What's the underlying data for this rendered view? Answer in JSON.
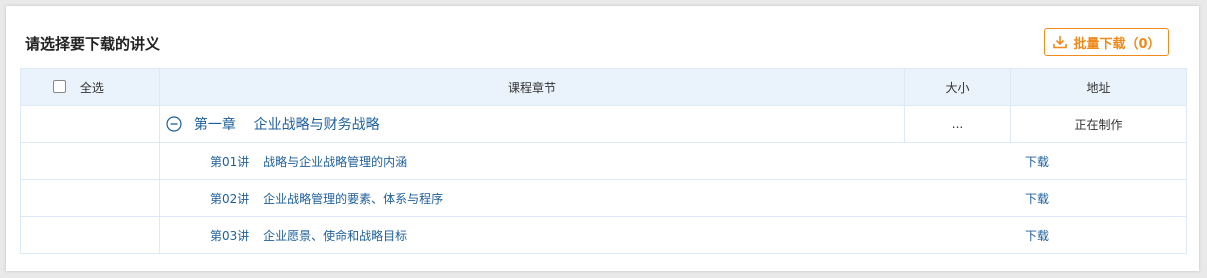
{
  "panel": {
    "title": "请选择要下载的讲义",
    "batch_download_label": "批量下载（0）"
  },
  "table": {
    "headers": {
      "select_all": "全选",
      "chapter": "课程章节",
      "size": "大小",
      "address": "地址"
    },
    "chapter": {
      "number": "第一章",
      "title": "企业战略与财务战略",
      "size": "...",
      "status": "正在制作"
    },
    "lectures": [
      {
        "number": "第01讲",
        "title": "战略与企业战略管理的内涵",
        "action": "下载"
      },
      {
        "number": "第02讲",
        "title": "企业战略管理的要素、体系与程序",
        "action": "下载"
      },
      {
        "number": "第03讲",
        "title": "企业愿景、使命和战略目标",
        "action": "下载"
      }
    ]
  },
  "colors": {
    "accent": "#f08a1c",
    "link": "#1e5f9b",
    "header_bg": "#eaf3fb",
    "border": "#dbeaf6"
  }
}
